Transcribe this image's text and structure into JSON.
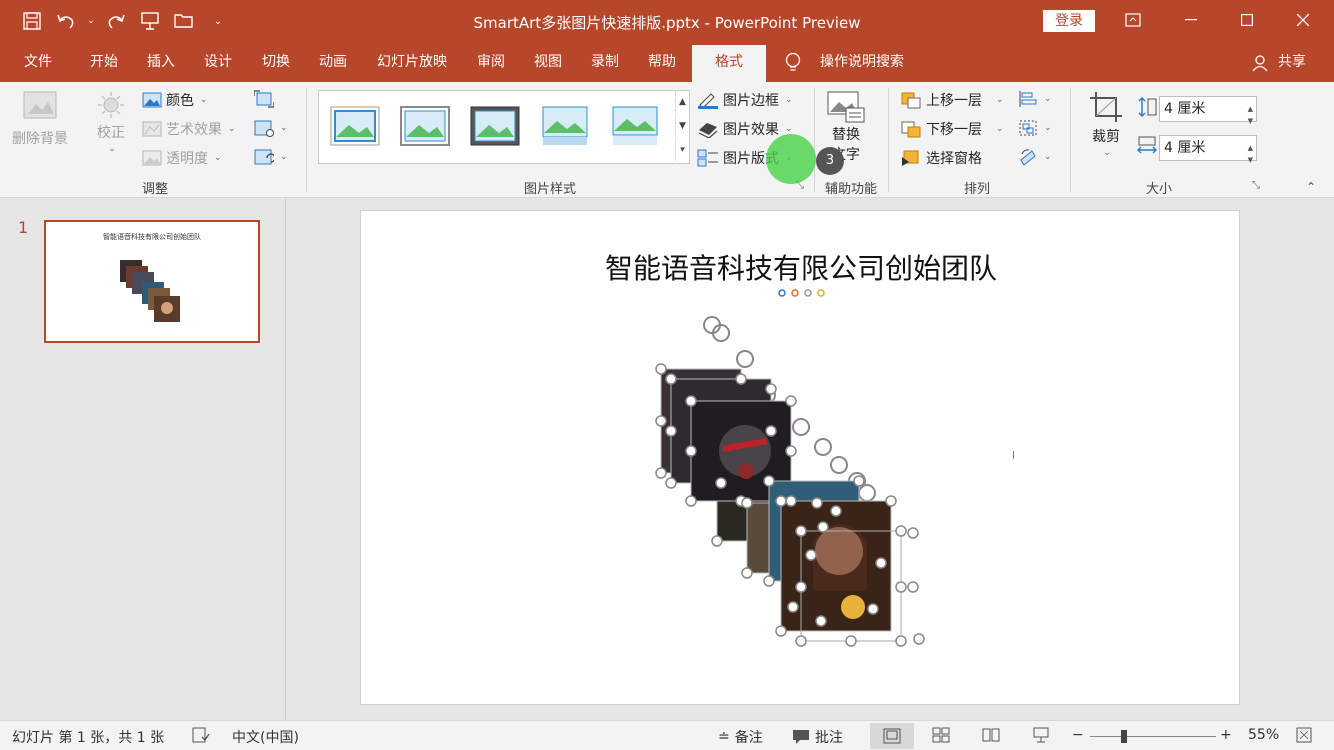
{
  "window": {
    "title": "SmartArt多张图片快速排版.pptx  -  PowerPoint Preview",
    "login_label": "登录"
  },
  "tabs": [
    {
      "label": "文件"
    },
    {
      "label": "开始"
    },
    {
      "label": "插入"
    },
    {
      "label": "设计"
    },
    {
      "label": "切换"
    },
    {
      "label": "动画"
    },
    {
      "label": "幻灯片放映"
    },
    {
      "label": "审阅"
    },
    {
      "label": "视图"
    },
    {
      "label": "录制"
    },
    {
      "label": "帮助"
    },
    {
      "label": "格式"
    }
  ],
  "tell_me": "操作说明搜索",
  "share_label": "共享",
  "ribbon": {
    "adjust": {
      "remove_bg": "删除背景",
      "correct": "校正",
      "color": "颜色",
      "art_effect": "艺术效果",
      "transparency": "透明度",
      "group_label": "调整"
    },
    "styles": {
      "border": "图片边框",
      "effect": "图片效果",
      "layout": "图片版式",
      "group_label": "图片样式"
    },
    "accessibility": {
      "alt_text_1": "替换",
      "alt_text_2": "文字",
      "group_label": "辅助功能"
    },
    "arrange": {
      "bring_forward": "上移一层",
      "send_backward": "下移一层",
      "selection_pane": "选择窗格",
      "group_label": "排列"
    },
    "size": {
      "crop": "裁剪",
      "height": "4 厘米",
      "width": "4 厘米",
      "group_label": "大小"
    }
  },
  "badge_number": "3",
  "slides": {
    "current_number": "1",
    "thumb_title": "智能语音科技有限公司创始团队"
  },
  "slide": {
    "title": "智能语音科技有限公司创始团队"
  },
  "status": {
    "slide_info": "幻灯片 第 1 张，共 1 张",
    "language": "中文(中国)",
    "notes": "备注",
    "comments": "批注",
    "zoom": "55%"
  },
  "colors": {
    "accent": "#b7472a",
    "hotspot": "#46d246"
  }
}
